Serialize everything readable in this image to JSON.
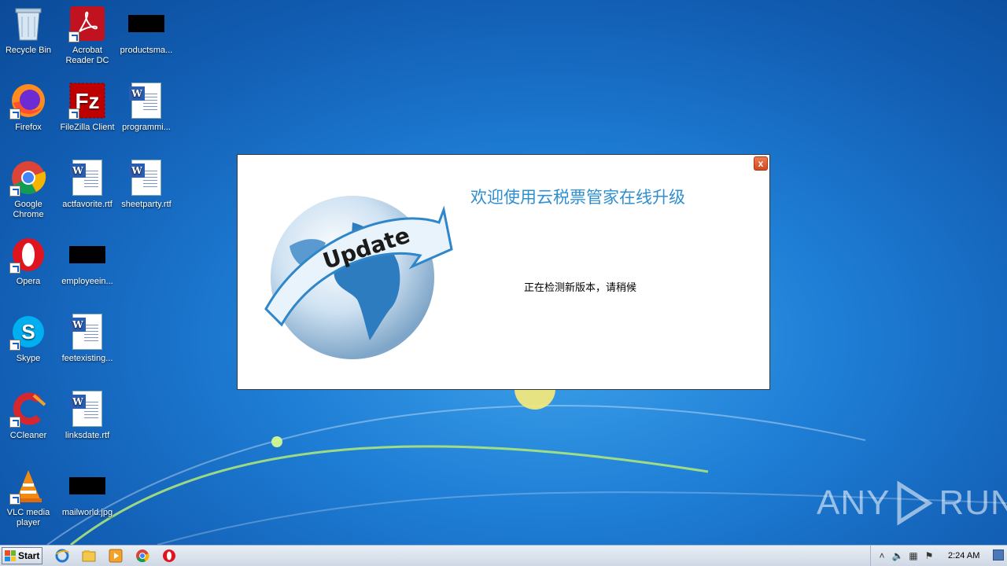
{
  "desktop": {
    "icons": [
      {
        "label": "Recycle Bin"
      },
      {
        "label": "Acrobat Reader DC"
      },
      {
        "label": "productsma..."
      },
      {
        "label": "Firefox"
      },
      {
        "label": "FileZilla Client"
      },
      {
        "label": "programmi..."
      },
      {
        "label": "Google Chrome"
      },
      {
        "label": "actfavorite.rtf"
      },
      {
        "label": "sheetparty.rtf"
      },
      {
        "label": "Opera"
      },
      {
        "label": "employeein..."
      },
      {
        "label": "Skype"
      },
      {
        "label": "feetexisting..."
      },
      {
        "label": "CCleaner"
      },
      {
        "label": "linksdate.rtf"
      },
      {
        "label": "VLC media player"
      },
      {
        "label": "mailworld.jpg"
      }
    ]
  },
  "dialog": {
    "title": "欢迎使用云税票管家在线升级",
    "status": "正在检测新版本，请稍候",
    "close_label": "x",
    "graphic_text": "Update"
  },
  "watermark": {
    "left": "ANY",
    "right": "RUN"
  },
  "taskbar": {
    "start_label": "Start",
    "clock": "2:24 AM"
  }
}
